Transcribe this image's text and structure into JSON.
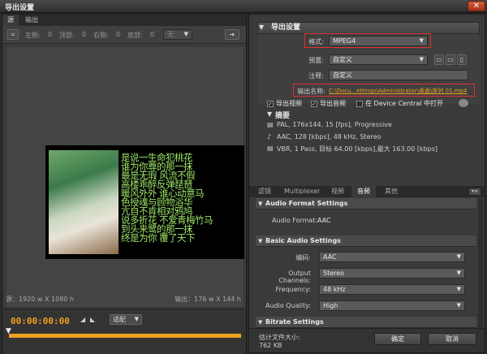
{
  "window": {
    "title": "导出设置",
    "close_label": "✕"
  },
  "left": {
    "tabs": [
      {
        "label": "源"
      },
      {
        "label": "输出"
      }
    ],
    "toolbar": {
      "left": "左侧:",
      "left_val": "0",
      "top": "顶部:",
      "top_val": "0",
      "right": "右侧:",
      "right_val": "0",
      "bottom": "底部:",
      "bottom_val": "0",
      "ratio_placeholder": "无"
    },
    "poem": [
      "是说一生命犯桃花",
      "谁为你尊的那一抹",
      "最是无瑕 风流不假",
      "高楼乖醉反弹琵琶",
      "暖风外外 谁心动意马",
      "色授魂与顾物浴华",
      "亢自不肯相对鸦鸠",
      "说多折花 不爱青梅竹马",
      "到头来鹭的那一抹",
      "终是为你 覆了天下"
    ],
    "source_status": "源：1920 w X 1080 h",
    "output_status": "输出：176 w X 144 h",
    "timecode": "00:00:00:00",
    "fit_label": "适配"
  },
  "right": {
    "export_settings_title": "导出设置",
    "format_label": "格式:",
    "format_value": "MPEG4",
    "preset_label": "预置:",
    "preset_value": "自定义",
    "comment_label": "注释:",
    "comment_value": "自定义",
    "output_name_label": "输出名称:",
    "output_name_value": "C:\\Docu...ettings\\Administrator\\桌面\\序列 01.mp4",
    "export_video": "导出视频",
    "export_audio": "导出音频",
    "open_device_central": "在 Device Central 中打开",
    "summary_title": "摘要",
    "summary_lines": [
      "PAL, 176x144, 15 [fps], Progressive",
      "AAC, 128 [kbps], 48 kHz, Stereo",
      "VBR, 1 Pass, 目标 64.00 [kbps],最大 163.00 [kbps]"
    ],
    "tabs": [
      {
        "label": "滤镜"
      },
      {
        "label": "Multiplexer"
      },
      {
        "label": "视频"
      },
      {
        "label": "音频"
      },
      {
        "label": "其他"
      }
    ],
    "audio_format_hdr": "Audio Format Settings",
    "audio_format_label": "Audio Format:",
    "audio_format_value": "AAC",
    "basic_audio_hdr": "Basic Audio Settings",
    "codec_label": "编码:",
    "codec_value": "AAC",
    "channels_label": "Output Channels:",
    "channels_value": "Stereo",
    "freq_label": "Frequency:",
    "freq_value": "48 kHz",
    "quality_label": "Audio Quality:",
    "quality_value": "High",
    "bitrate_hdr": "Bitrate Settings",
    "est_size_label": "估计文件大小:",
    "est_size_value": "762 KB",
    "ok_label": "确定",
    "cancel_label": "取消"
  }
}
